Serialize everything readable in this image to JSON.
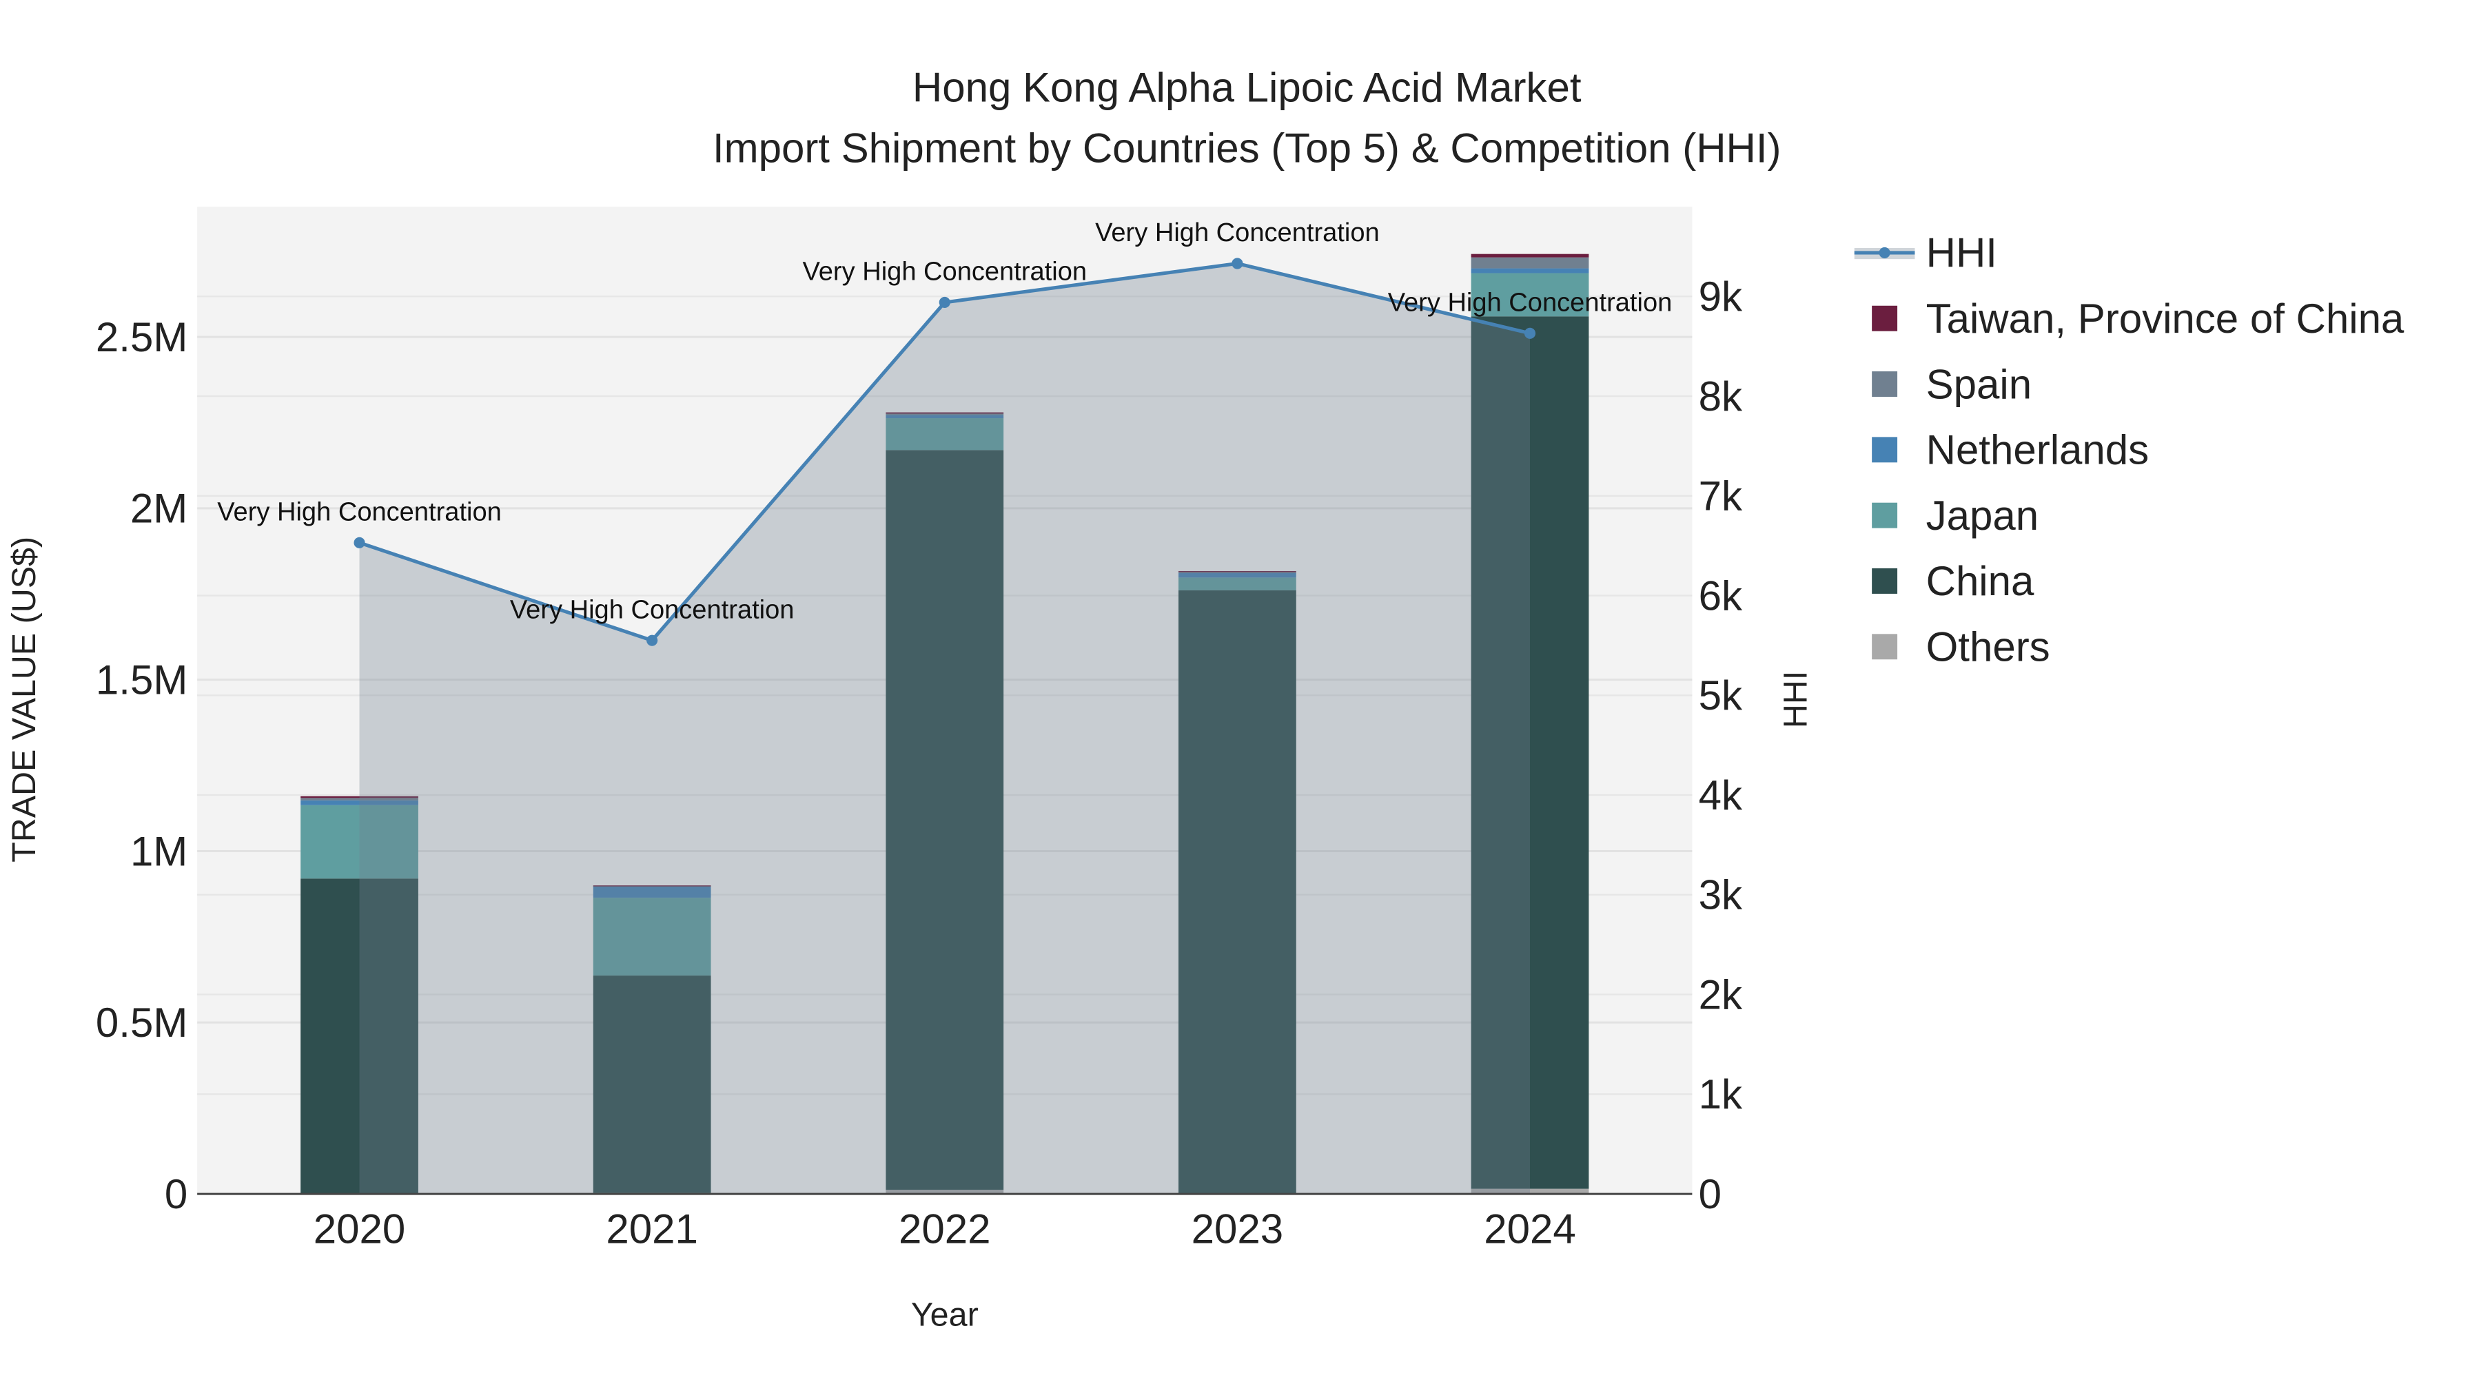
{
  "chart_data": {
    "type": "bar",
    "title": "Hong Kong Alpha Lipoic Acid Market",
    "subtitle": "Import Shipment by Countries (Top 5) & Competition (HHI)",
    "xlabel": "Year",
    "ylabel": "TRADE VALUE (US$)",
    "y2label": "HHI",
    "categories": [
      "2020",
      "2021",
      "2022",
      "2023",
      "2024"
    ],
    "ylim": [
      0,
      2880000
    ],
    "y2lim": [
      0,
      9900
    ],
    "yticks": [
      {
        "v": 0,
        "label": "0"
      },
      {
        "v": 500000,
        "label": "0.5M"
      },
      {
        "v": 1000000,
        "label": "1M"
      },
      {
        "v": 1500000,
        "label": "1.5M"
      },
      {
        "v": 2000000,
        "label": "2M"
      },
      {
        "v": 2500000,
        "label": "2.5M"
      }
    ],
    "y2ticks": [
      {
        "v": 0,
        "label": "0"
      },
      {
        "v": 1000,
        "label": "1k"
      },
      {
        "v": 2000,
        "label": "2k"
      },
      {
        "v": 3000,
        "label": "3k"
      },
      {
        "v": 4000,
        "label": "4k"
      },
      {
        "v": 5000,
        "label": "5k"
      },
      {
        "v": 6000,
        "label": "6k"
      },
      {
        "v": 7000,
        "label": "7k"
      },
      {
        "v": 8000,
        "label": "8k"
      },
      {
        "v": 9000,
        "label": "9k"
      }
    ],
    "series": [
      {
        "name": "Others",
        "color": "#A9A9A9",
        "values": [
          0,
          3000,
          12000,
          2000,
          15000
        ]
      },
      {
        "name": "China",
        "color": "#2F4F4F",
        "values": [
          920000,
          634000,
          2158000,
          1759000,
          2545000
        ]
      },
      {
        "name": "Japan",
        "color": "#5F9EA0",
        "values": [
          214000,
          227000,
          93000,
          37000,
          126000
        ]
      },
      {
        "name": "Netherlands",
        "color": "#4682B4",
        "values": [
          14000,
          33000,
          9000,
          14000,
          14000
        ]
      },
      {
        "name": "Spain",
        "color": "#708090",
        "values": [
          7000,
          2000,
          4000,
          2000,
          32000
        ]
      },
      {
        "name": "Taiwan, Province of China",
        "color": "#6B1E3F",
        "values": [
          5000,
          1000,
          4000,
          3000,
          10000
        ]
      }
    ],
    "hhi": {
      "name": "HHI",
      "color": "#4682B4",
      "values": [
        6530,
        5550,
        8940,
        9330,
        8630
      ],
      "labels": [
        "Very High Concentration",
        "Very High Concentration",
        "Very High Concentration",
        "Very High Concentration",
        "Very High Concentration"
      ]
    },
    "legend": [
      "HHI",
      "Taiwan, Province of China",
      "Spain",
      "Netherlands",
      "Japan",
      "China",
      "Others"
    ],
    "legend_position": "right",
    "grid": true
  }
}
